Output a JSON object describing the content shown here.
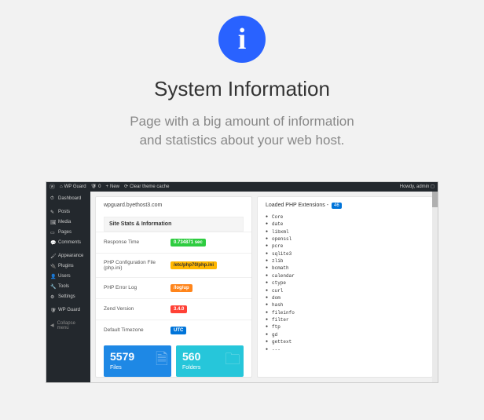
{
  "hero": {
    "icon_glyph": "i",
    "title": "System Information",
    "subtitle_l1": "Page with a big amount of information",
    "subtitle_l2": "and statistics about your web host."
  },
  "adminbar": {
    "site": "WP Guard",
    "shield": "0",
    "new": "New",
    "clear": "Clear theme cache",
    "howdy": "Howdy, admin"
  },
  "sidebar": {
    "items": [
      {
        "icon": "⏱",
        "label": "Dashboard"
      },
      {
        "icon": "✎",
        "label": "Posts"
      },
      {
        "icon": "🖼",
        "label": "Media"
      },
      {
        "icon": "▭",
        "label": "Pages"
      },
      {
        "icon": "💬",
        "label": "Comments"
      },
      {
        "icon": "🖌",
        "label": "Appearance"
      },
      {
        "icon": "🔌",
        "label": "Plugins"
      },
      {
        "icon": "👤",
        "label": "Users"
      },
      {
        "icon": "🔧",
        "label": "Tools"
      },
      {
        "icon": "⚙",
        "label": "Settings"
      },
      {
        "icon": "🛡",
        "label": "WP Guard"
      }
    ],
    "collapse": "Collapse menu"
  },
  "stats": {
    "host": "wpguard.byethost3.com",
    "header": "Site Stats & Information",
    "rows": [
      {
        "label": "Response Time",
        "value": "0.734871 sec",
        "cls": "b-green"
      },
      {
        "label": "PHP Configuration File (php.ini)",
        "value": "/etc/php70/php.ini",
        "cls": "b-yellow"
      },
      {
        "label": "PHP Error Log",
        "value": "/log/up",
        "cls": "b-orange"
      },
      {
        "label": "Zend Version",
        "value": "3.4.0",
        "cls": "b-red"
      },
      {
        "label": "Default Timezone",
        "value": "UTC",
        "cls": "b-blue"
      }
    ],
    "tiles": [
      {
        "num": "5579",
        "label": "Files",
        "cls": "tile-blue",
        "icon": "🗎"
      },
      {
        "num": "560",
        "label": "Folders",
        "cls": "tile-teal",
        "icon": "🗀"
      }
    ]
  },
  "extensions": {
    "title": "Loaded PHP Extensions -",
    "count": "46",
    "list": [
      "Core",
      "date",
      "libxml",
      "openssl",
      "pcre",
      "sqlite3",
      "zlib",
      "bcmath",
      "calendar",
      "ctype",
      "curl",
      "dom",
      "hash",
      "fileinfo",
      "filter",
      "ftp",
      "gd",
      "gettext",
      "---"
    ]
  }
}
